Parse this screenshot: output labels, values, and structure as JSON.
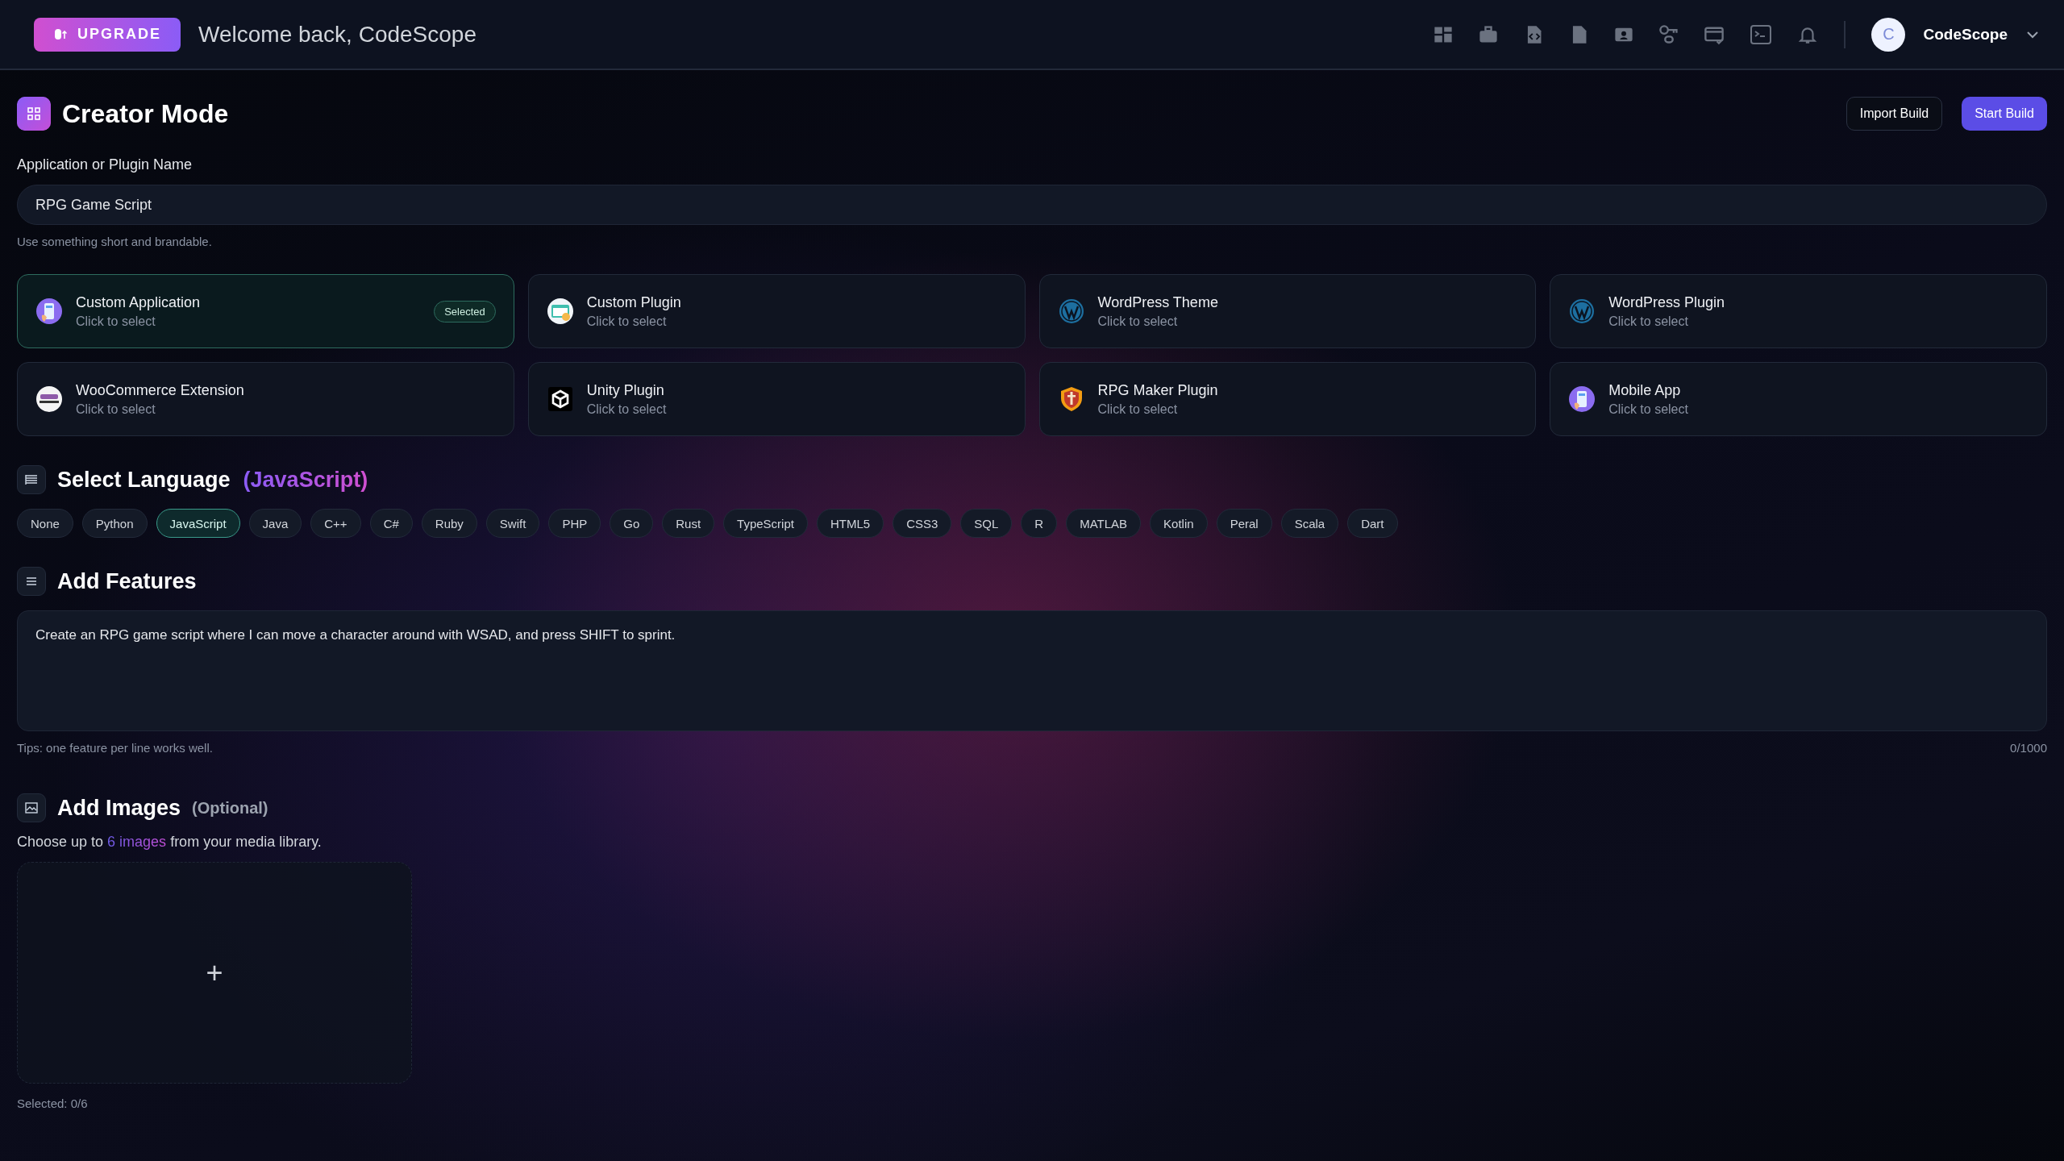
{
  "topbar": {
    "upgrade": "UPGRADE",
    "welcome": "Welcome back, CodeScope",
    "avatar_initial": "C",
    "user": "CodeScope"
  },
  "header": {
    "title": "Creator Mode",
    "buttons": [
      {
        "label": "Import Build",
        "kind": "secondary"
      },
      {
        "label": "Start Build",
        "kind": "primary"
      }
    ]
  },
  "name_field": {
    "label": "Application or Plugin Name",
    "value": "RPG Game Script",
    "hint": "Use something short and brandable."
  },
  "project_types": [
    {
      "kind": "app",
      "title": "Custom Application",
      "subtitle": "Click to select",
      "selected": true,
      "badge": "Selected"
    },
    {
      "kind": "plugin",
      "title": "Custom Plugin",
      "subtitle": "Click to select",
      "selected": false
    },
    {
      "kind": "wordpress",
      "title": "WordPress Theme",
      "subtitle": "Click to select",
      "selected": false
    },
    {
      "kind": "wordpress",
      "title": "WordPress Plugin",
      "subtitle": "Click to select",
      "selected": false
    },
    {
      "kind": "woocommerce",
      "title": "WooCommerce Extension",
      "subtitle": "Click to select",
      "selected": false
    },
    {
      "kind": "unity",
      "title": "Unity Plugin",
      "subtitle": "Click to select",
      "selected": false
    },
    {
      "kind": "shield",
      "title": "RPG Maker Plugin",
      "subtitle": "Click to select",
      "selected": false
    },
    {
      "kind": "mobile",
      "title": "Mobile App",
      "subtitle": "Click to select",
      "selected": false
    }
  ],
  "language": {
    "title": "Select Language",
    "current": "(JavaScript)",
    "options": [
      {
        "label": "None",
        "selected": false
      },
      {
        "label": "Python",
        "selected": false
      },
      {
        "label": "JavaScript",
        "selected": true
      },
      {
        "label": "Java",
        "selected": false
      },
      {
        "label": "C++",
        "selected": false
      },
      {
        "label": "C#",
        "selected": false
      },
      {
        "label": "Ruby",
        "selected": false
      },
      {
        "label": "Swift",
        "selected": false
      },
      {
        "label": "PHP",
        "selected": false
      },
      {
        "label": "Go",
        "selected": false
      },
      {
        "label": "Rust",
        "selected": false
      },
      {
        "label": "TypeScript",
        "selected": false
      },
      {
        "label": "HTML5",
        "selected": false
      },
      {
        "label": "CSS3",
        "selected": false
      },
      {
        "label": "SQL",
        "selected": false
      },
      {
        "label": "R",
        "selected": false
      },
      {
        "label": "MATLAB",
        "selected": false
      },
      {
        "label": "Kotlin",
        "selected": false
      },
      {
        "label": "Peral",
        "selected": false
      },
      {
        "label": "Scala",
        "selected": false
      },
      {
        "label": "Dart",
        "selected": false
      }
    ]
  },
  "features": {
    "title": "Add Features",
    "value": "Create an RPG game script where I can move a character around with WSAD, and press SHIFT to sprint.",
    "tip": "Tips: one feature per line works well.",
    "counter": "0/1000"
  },
  "images": {
    "title": "Add Images",
    "optional": "(Optional)",
    "text_before": "Choose up to ",
    "link": "6 images",
    "text_after": " from your media library.",
    "add": "+",
    "selected_count": "Selected: 0/6"
  }
}
